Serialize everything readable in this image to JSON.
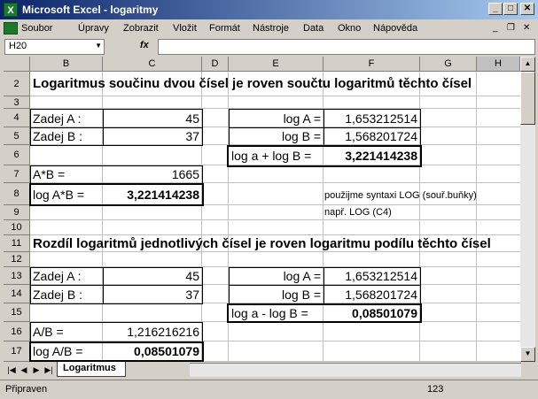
{
  "window": {
    "title": "Microsoft Excel - logaritmy"
  },
  "menu": [
    "Soubor",
    "Úpravy",
    "Zobrazit",
    "Vložit",
    "Formát",
    "Nástroje",
    "Data",
    "Okno",
    "Nápověda"
  ],
  "formula_bar": {
    "name_box": "H20",
    "fx_label": "fx",
    "formula": ""
  },
  "columns": [
    "",
    "B",
    "C",
    "D",
    "E",
    "F",
    "G",
    "H"
  ],
  "rows": [
    "2",
    "3",
    "4",
    "5",
    "6",
    "7",
    "8",
    "9",
    "10",
    "11",
    "12",
    "13",
    "14",
    "15",
    "16",
    "17"
  ],
  "cells": {
    "h1": "Logaritmus součinu dvou čísel je roven součtu logaritmů těchto čísel",
    "b4": "Zadej A :",
    "c4": "45",
    "b5": "Zadej B :",
    "c5": "37",
    "e4": "log A =",
    "f4": "1,653212514",
    "e5": "log B =",
    "f5": "1,568201724",
    "e6": "log a + log B =",
    "f6": "3,221414238",
    "b7": "A*B =",
    "c7": "1665",
    "b8": "log A*B =",
    "c8": "3,221414238",
    "note1": "použijme syntaxi LOG (souř.buňky)",
    "note2": "např. LOG (C4)",
    "h2": "Rozdíl logaritmů jednotlivých čísel je roven logaritmu podílu těchto čísel",
    "b13": "Zadej A :",
    "c13": "45",
    "b14": "Zadej B :",
    "c14": "37",
    "e13": "log A =",
    "f13": "1,653212514",
    "e14": "log B =",
    "f14": "1,568201724",
    "e15": "log a - log B =",
    "f15": "0,08501079",
    "b16": "A/B =",
    "c16": "1,216216216",
    "b17": "log A/B =",
    "c17": "0,08501079"
  },
  "sheet_tab": "Logaritmus",
  "status": {
    "text": "Připraven",
    "num": "123"
  }
}
